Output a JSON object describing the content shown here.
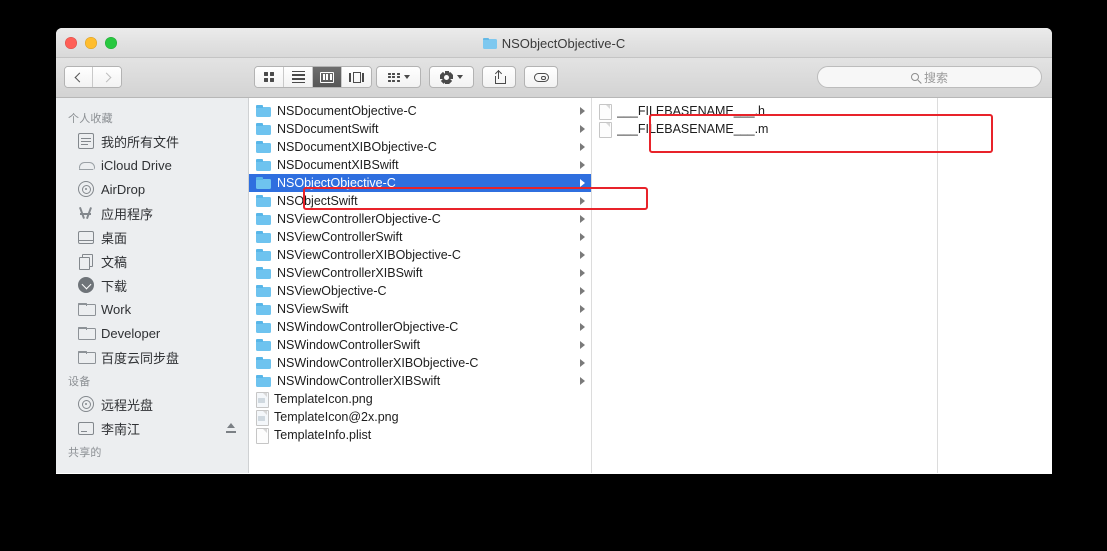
{
  "window": {
    "title": "NSObjectObjective-C",
    "title_icon": "folder-icon",
    "traffic_lights": [
      {
        "name": "close",
        "color": "#ff5f57"
      },
      {
        "name": "minimize",
        "color": "#ffbd2e"
      },
      {
        "name": "maximize",
        "color": "#28c840"
      }
    ]
  },
  "toolbar": {
    "nav": {
      "back_icon": "chevron-left-icon",
      "forward_icon": "chevron-right-icon"
    },
    "view_modes": [
      {
        "icon": "icon-view-icon",
        "label": "Icon View",
        "active": false
      },
      {
        "icon": "list-view-icon",
        "label": "List View",
        "active": false
      },
      {
        "icon": "column-view-icon",
        "label": "Column View",
        "active": true
      },
      {
        "icon": "gallery-view-icon",
        "label": "Gallery View",
        "active": false
      }
    ],
    "arrange": {
      "icon": "arrange-icon",
      "caret": "chevron-down-icon"
    },
    "action": {
      "icon": "gear-icon",
      "caret": "chevron-down-icon"
    },
    "share": {
      "icon": "share-icon"
    },
    "tags": {
      "icon": "tag-icon"
    },
    "search": {
      "icon": "search-icon",
      "placeholder": "搜索",
      "value": ""
    }
  },
  "sidebar": {
    "sections": [
      {
        "title": "个人收藏",
        "items": [
          {
            "label": "我的所有文件",
            "icon": "all-files-icon"
          },
          {
            "label": "iCloud Drive",
            "icon": "cloud-icon"
          },
          {
            "label": "AirDrop",
            "icon": "airdrop-icon"
          },
          {
            "label": "应用程序",
            "icon": "applications-icon"
          },
          {
            "label": "桌面",
            "icon": "desktop-icon"
          },
          {
            "label": "文稿",
            "icon": "documents-icon"
          },
          {
            "label": "下载",
            "icon": "downloads-icon"
          },
          {
            "label": "Work",
            "icon": "folder-icon"
          },
          {
            "label": "Developer",
            "icon": "folder-icon"
          },
          {
            "label": "百度云同步盘",
            "icon": "folder-icon"
          }
        ]
      },
      {
        "title": "设备",
        "items": [
          {
            "label": "远程光盘",
            "icon": "optical-disc-icon"
          },
          {
            "label": "李南江",
            "icon": "hard-disk-icon",
            "eject": true
          }
        ]
      },
      {
        "title": "共享的",
        "items": []
      }
    ]
  },
  "columns": [
    {
      "name": "column-1",
      "rows": [
        {
          "label": "NSDocumentObjective-C",
          "type": "folder",
          "disclosure": true,
          "selected": false
        },
        {
          "label": "NSDocumentSwift",
          "type": "folder",
          "disclosure": true,
          "selected": false
        },
        {
          "label": "NSDocumentXIBObjective-C",
          "type": "folder",
          "disclosure": true,
          "selected": false
        },
        {
          "label": "NSDocumentXIBSwift",
          "type": "folder",
          "disclosure": true,
          "selected": false
        },
        {
          "label": "NSObjectObjective-C",
          "type": "folder",
          "disclosure": true,
          "selected": true
        },
        {
          "label": "NSObjectSwift",
          "type": "folder",
          "disclosure": true,
          "selected": false
        },
        {
          "label": "NSViewControllerObjective-C",
          "type": "folder",
          "disclosure": true,
          "selected": false
        },
        {
          "label": "NSViewControllerSwift",
          "type": "folder",
          "disclosure": true,
          "selected": false
        },
        {
          "label": "NSViewControllerXIBObjective-C",
          "type": "folder",
          "disclosure": true,
          "selected": false
        },
        {
          "label": "NSViewControllerXIBSwift",
          "type": "folder",
          "disclosure": true,
          "selected": false
        },
        {
          "label": "NSViewObjective-C",
          "type": "folder",
          "disclosure": true,
          "selected": false
        },
        {
          "label": "NSViewSwift",
          "type": "folder",
          "disclosure": true,
          "selected": false
        },
        {
          "label": "NSWindowControllerObjective-C",
          "type": "folder",
          "disclosure": true,
          "selected": false
        },
        {
          "label": "NSWindowControllerSwift",
          "type": "folder",
          "disclosure": true,
          "selected": false
        },
        {
          "label": "NSWindowControllerXIBObjective-C",
          "type": "folder",
          "disclosure": true,
          "selected": false
        },
        {
          "label": "NSWindowControllerXIBSwift",
          "type": "folder",
          "disclosure": true,
          "selected": false
        },
        {
          "label": "TemplateIcon.png",
          "type": "image",
          "disclosure": false,
          "selected": false
        },
        {
          "label": "TemplateIcon@2x.png",
          "type": "image",
          "disclosure": false,
          "selected": false
        },
        {
          "label": "TemplateInfo.plist",
          "type": "document",
          "disclosure": false,
          "selected": false
        }
      ]
    },
    {
      "name": "column-2",
      "rows": [
        {
          "label": "___FILEBASENAME___.h",
          "type": "document",
          "disclosure": false,
          "selected": false
        },
        {
          "label": "___FILEBASENAME___.m",
          "type": "document",
          "disclosure": false,
          "selected": false
        }
      ]
    },
    {
      "name": "column-3",
      "rows": []
    }
  ],
  "annotations": [
    {
      "name": "selected-folder-highlight",
      "color": "#e8232a",
      "target": "NSObjectObjective-C"
    },
    {
      "name": "template-files-highlight",
      "color": "#e8232a",
      "target": "___FILEBASENAME___ files"
    }
  ],
  "colors": {
    "selection_blue": "#2f6fdf",
    "annotation_red": "#e8232a",
    "folder_blue": "#6ec3ef",
    "sidebar_bg": "#eceef0"
  }
}
